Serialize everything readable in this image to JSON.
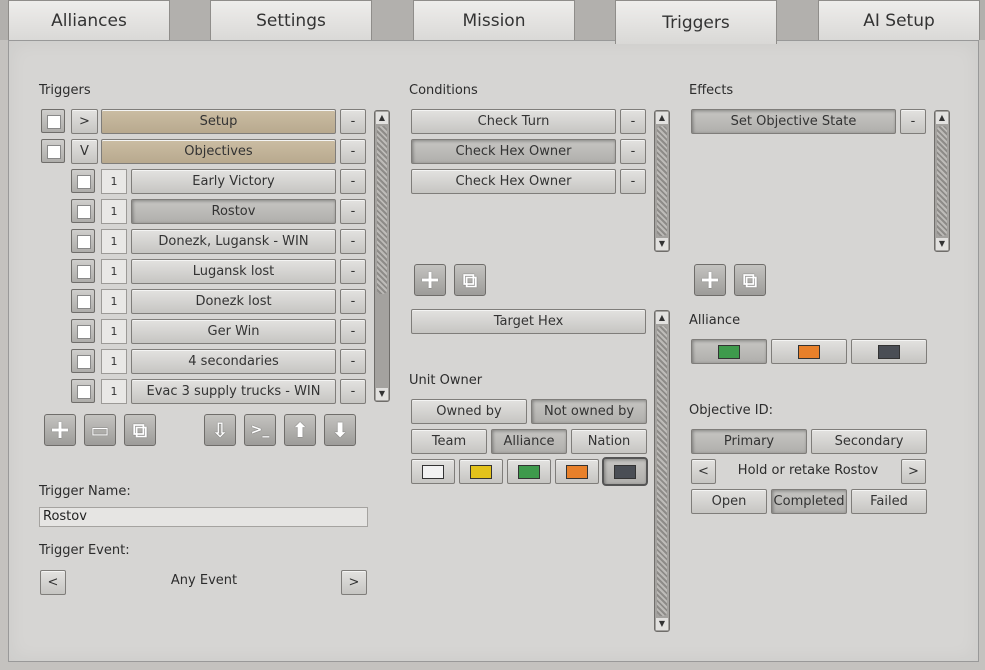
{
  "tabs": [
    "Alliances",
    "Settings",
    "Mission",
    "Triggers",
    "AI Setup"
  ],
  "triggers": {
    "heading": "Triggers",
    "groups": [
      {
        "toggle": ">",
        "label": "Setup",
        "minus": "-"
      },
      {
        "toggle": "V",
        "label": "Objectives",
        "minus": "-"
      }
    ],
    "items": [
      {
        "num": "1",
        "label": "Early Victory",
        "minus": "-"
      },
      {
        "num": "1",
        "label": "Rostov",
        "minus": "-"
      },
      {
        "num": "1",
        "label": "Donezk, Lugansk - WIN",
        "minus": "-"
      },
      {
        "num": "1",
        "label": "Lugansk lost",
        "minus": "-"
      },
      {
        "num": "1",
        "label": "Donezk lost",
        "minus": "-"
      },
      {
        "num": "1",
        "label": "Ger Win",
        "minus": "-"
      },
      {
        "num": "1",
        "label": "4 secondaries",
        "minus": "-"
      },
      {
        "num": "1",
        "label": "Evac 3 supply trucks - WIN",
        "minus": "-"
      }
    ],
    "name_label": "Trigger Name:",
    "name_value": "Rostov",
    "event_label": "Trigger Event:",
    "event_value": "Any Event",
    "prev": "<",
    "next": ">"
  },
  "conditions": {
    "heading": "Conditions",
    "items": [
      {
        "label": "Check Turn",
        "minus": "-"
      },
      {
        "label": "Check Hex Owner",
        "minus": "-"
      },
      {
        "label": "Check Hex Owner",
        "minus": "-"
      }
    ],
    "target_hex": "Target Hex",
    "unit_owner_label": "Unit Owner",
    "owned_by": "Owned by",
    "not_owned_by": "Not owned by",
    "team": "Team",
    "alliance": "Alliance",
    "nation": "Nation",
    "colors": [
      "#f2f2f2",
      "#e3c21b",
      "#3e9a4c",
      "#e8802a",
      "#4a4e55"
    ]
  },
  "effects": {
    "heading": "Effects",
    "items": [
      {
        "label": "Set Objective State",
        "minus": "-"
      }
    ],
    "alliance_label": "Alliance",
    "alliance_colors": [
      "#3e9a4c",
      "#e8802a",
      "#4a4e55"
    ],
    "objective_id_label": "Objective ID:",
    "primary": "Primary",
    "secondary": "Secondary",
    "objective_name": "Hold or retake Rostov",
    "prev": "<",
    "next": ">",
    "open": "Open",
    "completed": "Completed",
    "failed": "Failed"
  },
  "icons": {
    "plus": "+",
    "copy": "⧉",
    "folder": "▭",
    "import": "⇩",
    "console": ">_",
    "up": "⬆",
    "down": "⬇",
    "scroll_up": "▲",
    "scroll_down": "▼"
  }
}
